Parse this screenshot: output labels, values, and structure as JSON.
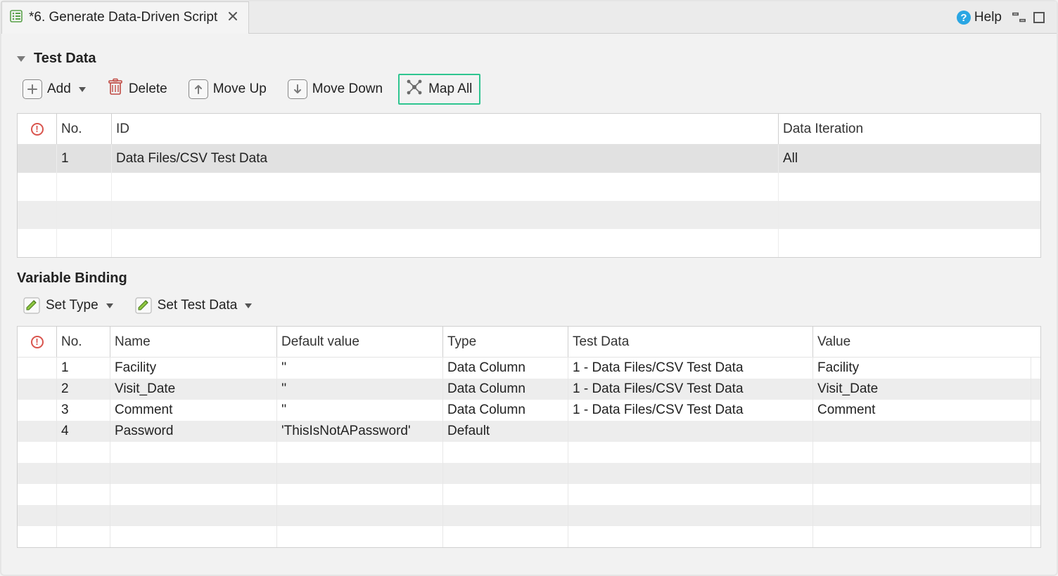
{
  "tab": {
    "title": "*6. Generate Data-Driven Script"
  },
  "help": {
    "label": "Help"
  },
  "sections": {
    "test_data": {
      "title": "Test Data",
      "toolbar": {
        "add": "Add",
        "delete": "Delete",
        "move_up": "Move Up",
        "move_down": "Move Down",
        "map_all": "Map All"
      },
      "columns": {
        "no": "No.",
        "id": "ID",
        "iteration": "Data Iteration"
      },
      "rows": [
        {
          "no": "1",
          "id": "Data Files/CSV Test Data",
          "iteration": "All"
        }
      ]
    },
    "variable_binding": {
      "title": "Variable Binding",
      "toolbar": {
        "set_type": "Set Type",
        "set_test_data": "Set Test Data"
      },
      "columns": {
        "no": "No.",
        "name": "Name",
        "default": "Default value",
        "type": "Type",
        "test_data": "Test Data",
        "value": "Value"
      },
      "rows": [
        {
          "no": "1",
          "name": "Facility",
          "default": "''",
          "type": "Data Column",
          "test_data": "1 - Data Files/CSV Test Data",
          "value": "Facility"
        },
        {
          "no": "2",
          "name": "Visit_Date",
          "default": "''",
          "type": "Data Column",
          "test_data": "1 - Data Files/CSV Test Data",
          "value": "Visit_Date"
        },
        {
          "no": "3",
          "name": "Comment",
          "default": "''",
          "type": "Data Column",
          "test_data": "1 - Data Files/CSV Test Data",
          "value": "Comment"
        },
        {
          "no": "4",
          "name": "Password",
          "default": "'ThisIsNotAPassword'",
          "type": "Default",
          "test_data": "",
          "value": ""
        }
      ]
    }
  }
}
